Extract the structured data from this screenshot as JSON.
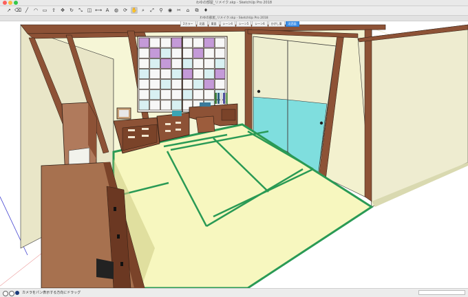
{
  "window": {
    "title": "わゆの部屋_リメイク.skp - SketchUp Pro 2018"
  },
  "document": {
    "title": "わゆの部屋_リメイク.skp - SketchUp Pro 2018"
  },
  "toolbar": {
    "tools": [
      {
        "name": "select",
        "glyph": "➚"
      },
      {
        "name": "eraser",
        "glyph": "⌫"
      },
      {
        "name": "line",
        "glyph": "╱"
      },
      {
        "name": "arc",
        "glyph": "◠"
      },
      {
        "name": "rectangle",
        "glyph": "▭"
      },
      {
        "name": "push-pull",
        "glyph": "⇧"
      },
      {
        "name": "move",
        "glyph": "✥"
      },
      {
        "name": "rotate",
        "glyph": "↻"
      },
      {
        "name": "scale",
        "glyph": "⤡"
      },
      {
        "name": "offset",
        "glyph": "◫"
      },
      {
        "name": "tape",
        "glyph": "⟷"
      },
      {
        "name": "text",
        "glyph": "A"
      },
      {
        "name": "paint",
        "glyph": "◍"
      },
      {
        "name": "orbit",
        "glyph": "⟳"
      },
      {
        "name": "pan",
        "glyph": "✋"
      },
      {
        "name": "zoom",
        "glyph": "⌕"
      },
      {
        "name": "zoom-extents",
        "glyph": "⤢"
      },
      {
        "name": "walk",
        "glyph": "⚲"
      },
      {
        "name": "look-around",
        "glyph": "◉"
      },
      {
        "name": "section",
        "glyph": "✂"
      },
      {
        "name": "warehouse",
        "glyph": "⌂"
      },
      {
        "name": "extensions",
        "glyph": "⧉"
      },
      {
        "name": "ruby",
        "glyph": "♦"
      }
    ],
    "active_tool": "pan"
  },
  "scene_tabs": [
    "2カラー",
    "北面",
    "東面",
    "シーン4",
    "シーン5",
    "シーン6",
    "ひがし東",
    "北西面"
  ],
  "active_scene_index": 7,
  "status": {
    "message": "カメラをパン表示する方向にドラッグ",
    "measurements_label": "",
    "measurements_value": ""
  },
  "colors": {
    "tatami": "#f7f7bf",
    "tatami_border": "#2a9a55",
    "wood": "#8d5236",
    "wall": "#f6f6d6",
    "fusuma_blue": "#7fdede",
    "window_purple": "#c49ad8",
    "window_cyan": "#d8f0f2",
    "accent": "#3d8fe8"
  }
}
